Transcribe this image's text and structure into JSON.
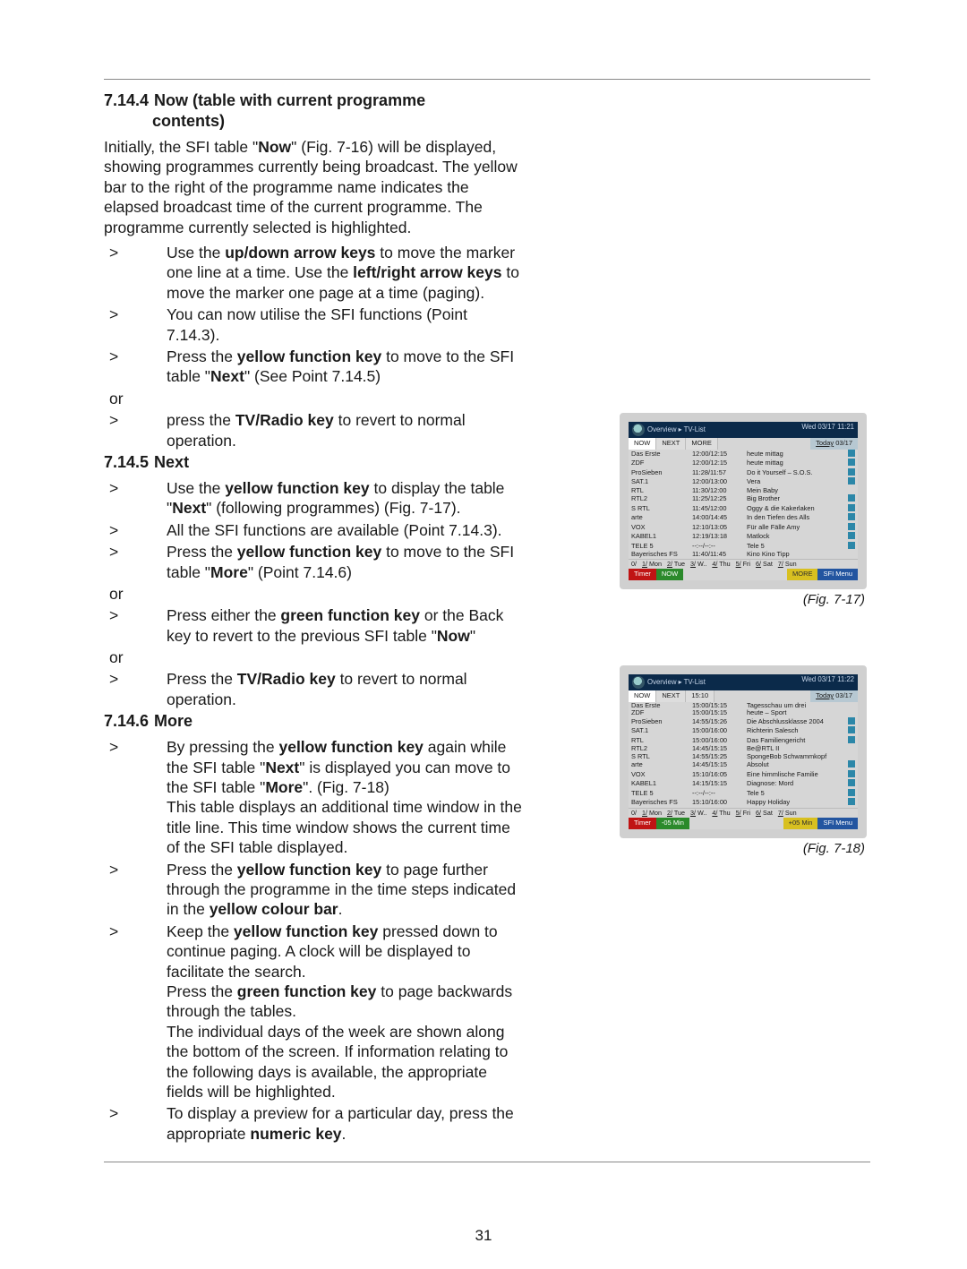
{
  "page_number": "31",
  "sections": {
    "s1": {
      "num": "7.14.4",
      "title_line1": "Now (table with current programme",
      "title_line2": "contents)",
      "intro_html": "Initially, the SFI table \"<b>Now</b>\" (Fig. 7-16) will be displayed, showing programmes currently being broadcast. The yellow bar to the right of the programme name indicates the elapsed broadcast time of the current programme. The programme currently selected is highlighted.",
      "items": [
        "Use the <b>up/down arrow keys</b> to move the marker one line at a time. Use the <b>left/right arrow keys</b> to move the marker one page at a time (paging).",
        "You can now utilise the SFI functions (Point 7.14.3).",
        "Press the <b>yellow function key</b> to move to the SFI table \"<b>Next</b>\" (See Point 7.14.5)"
      ],
      "or1": "or",
      "items2": [
        "press the <b>TV/Radio key</b> to revert to normal operation."
      ]
    },
    "s2": {
      "num": "7.14.5",
      "title": "Next",
      "items": [
        "Use the <b>yellow function key</b> to display the table \"<b>Next</b>\" (following programmes) (Fig. 7-17).",
        "All the SFI functions are available (Point 7.14.3).",
        "Press the <b>yellow function key</b> to move to the SFI table \"<b>More</b>\" (Point 7.14.6)"
      ],
      "or1": "or",
      "items2": [
        "Press either the <b>green function key</b> or the Back key to revert to the previous SFI table \"<b>Now</b>\""
      ],
      "or2": "or",
      "items3": [
        "Press the <b>TV/Radio key</b> to revert to normal operation."
      ]
    },
    "s3": {
      "num": "7.14.6",
      "title": "More",
      "items": [
        "By pressing the <b>yellow function key</b> again while the SFI table \"<b>Next</b>\" is displayed you can move to the SFI table \"<b>More</b>\". (Fig. 7-18)<br>This table displays an additional time window in the title line. This time window shows the current time of the SFI table displayed.",
        "Press the <b>yellow function key</b> to page further through the programme in the time steps indicated in the <b>yellow colour bar</b>.",
        "Keep the <b>yellow function key</b> pressed down to continue paging. A clock will be displayed to facilitate the search.<br>Press the <b>green function key</b> to page backwards through the tables.<br>The individual days of the week are shown along the bottom of the screen. If information relating to the following days is available, the appropriate fields will be highlighted.",
        "To display a preview for a particular day, press the appropriate <b>numeric key</b>."
      ]
    }
  },
  "fig17": {
    "caption": "(Fig. 7-17)",
    "breadcrumb": "Overview ▸ TV-List",
    "clock": "Wed 03/17  11:21",
    "tabs": {
      "now": "NOW",
      "next": "NEXT",
      "more": "MORE",
      "date_label": "Today",
      "date_val": "03/17"
    },
    "rows": [
      {
        "ch": "Das Erste",
        "tm": "12:00/12:15",
        "pg": "heute mittag",
        "ic": true
      },
      {
        "ch": "ZDF",
        "tm": "12:00/12:15",
        "pg": "heute mittag",
        "ic": true
      },
      {
        "ch": "ProSieben",
        "tm": "11:28/11:57",
        "pg": "Do it Yourself – S.O.S.",
        "ic": true
      },
      {
        "ch": "SAT.1",
        "tm": "12:00/13:00",
        "pg": "Vera",
        "ic": true
      },
      {
        "ch": "RTL",
        "tm": "11:30/12:00",
        "pg": "Mein Baby",
        "ic": false
      },
      {
        "ch": "RTL2",
        "tm": "11:25/12:25",
        "pg": "Big Brother",
        "ic": true
      },
      {
        "ch": "S RTL",
        "tm": "11:45/12:00",
        "pg": "Oggy & die Kakerlaken",
        "ic": true
      },
      {
        "ch": "arte",
        "tm": "14:00/14:45",
        "pg": "In den Tiefen des Alls",
        "ic": true
      },
      {
        "ch": "VOX",
        "tm": "12:10/13:05",
        "pg": "Für alle Fälle Amy",
        "ic": true
      },
      {
        "ch": "KABEL1",
        "tm": "12:19/13:18",
        "pg": "Matlock",
        "ic": true
      },
      {
        "ch": "TELE 5",
        "tm": "--:--/--:--",
        "pg": "Tele 5",
        "ic": true
      },
      {
        "ch": "Bayerisches FS",
        "tm": "11:40/11:45",
        "pg": "Kino Kino Tipp",
        "ic": false
      }
    ],
    "days": [
      "0/",
      "1/ Mon",
      "2/ Tue",
      "3/ W..",
      "4/ Thu",
      "5/ Fri",
      "6/ Sat",
      "7/ Sun"
    ],
    "foot": {
      "timer": "Timer",
      "green": "NOW",
      "yellow": "MORE",
      "blue": "SFI Menu"
    }
  },
  "fig18": {
    "caption": "(Fig. 7-18)",
    "breadcrumb": "Overview ▸ TV-List",
    "clock": "Wed 03/17  11:22",
    "tabs": {
      "now": "NOW",
      "next": "NEXT",
      "more": "15:10",
      "date_label": "Today",
      "date_val": "03/17"
    },
    "rows": [
      {
        "ch": "Das Erste",
        "tm": "15:00/15:15",
        "pg": "Tagesschau um drei",
        "ic": false
      },
      {
        "ch": "ZDF",
        "tm": "15:00/15:15",
        "pg": "heute – Sport",
        "ic": false
      },
      {
        "ch": "ProSieben",
        "tm": "14:55/15:26",
        "pg": "Die Abschlussklasse 2004",
        "ic": true
      },
      {
        "ch": "SAT.1",
        "tm": "15:00/16:00",
        "pg": "Richterin Salesch",
        "ic": true
      },
      {
        "ch": "RTL",
        "tm": "15:00/16:00",
        "pg": "Das Familiengericht",
        "ic": true
      },
      {
        "ch": "RTL2",
        "tm": "14:45/15:15",
        "pg": "Be@RTL II",
        "ic": false
      },
      {
        "ch": "S RTL",
        "tm": "14:55/15:25",
        "pg": "SpongeBob Schwammkopf",
        "ic": false
      },
      {
        "ch": "arte",
        "tm": "14:45/15:15",
        "pg": "Absolut",
        "ic": true
      },
      {
        "ch": "VOX",
        "tm": "15:10/16:05",
        "pg": "Eine himmlische Familie",
        "ic": true
      },
      {
        "ch": "KABEL1",
        "tm": "14:15/15:15",
        "pg": "Diagnose: Mord",
        "ic": true
      },
      {
        "ch": "TELE 5",
        "tm": "--:--/--:--",
        "pg": "Tele 5",
        "ic": true
      },
      {
        "ch": "Bayerisches FS",
        "tm": "15:10/16:00",
        "pg": "Happy Holiday",
        "ic": true
      }
    ],
    "days": [
      "0/",
      "1/ Mon",
      "2/ Tue",
      "3/ W..",
      "4/ Thu",
      "5/ Fri",
      "6/ Sat",
      "7/ Sun"
    ],
    "foot": {
      "timer": "Timer",
      "green": "-05 Min",
      "yellow": "+05 Min",
      "blue": "SFI Menu"
    }
  }
}
